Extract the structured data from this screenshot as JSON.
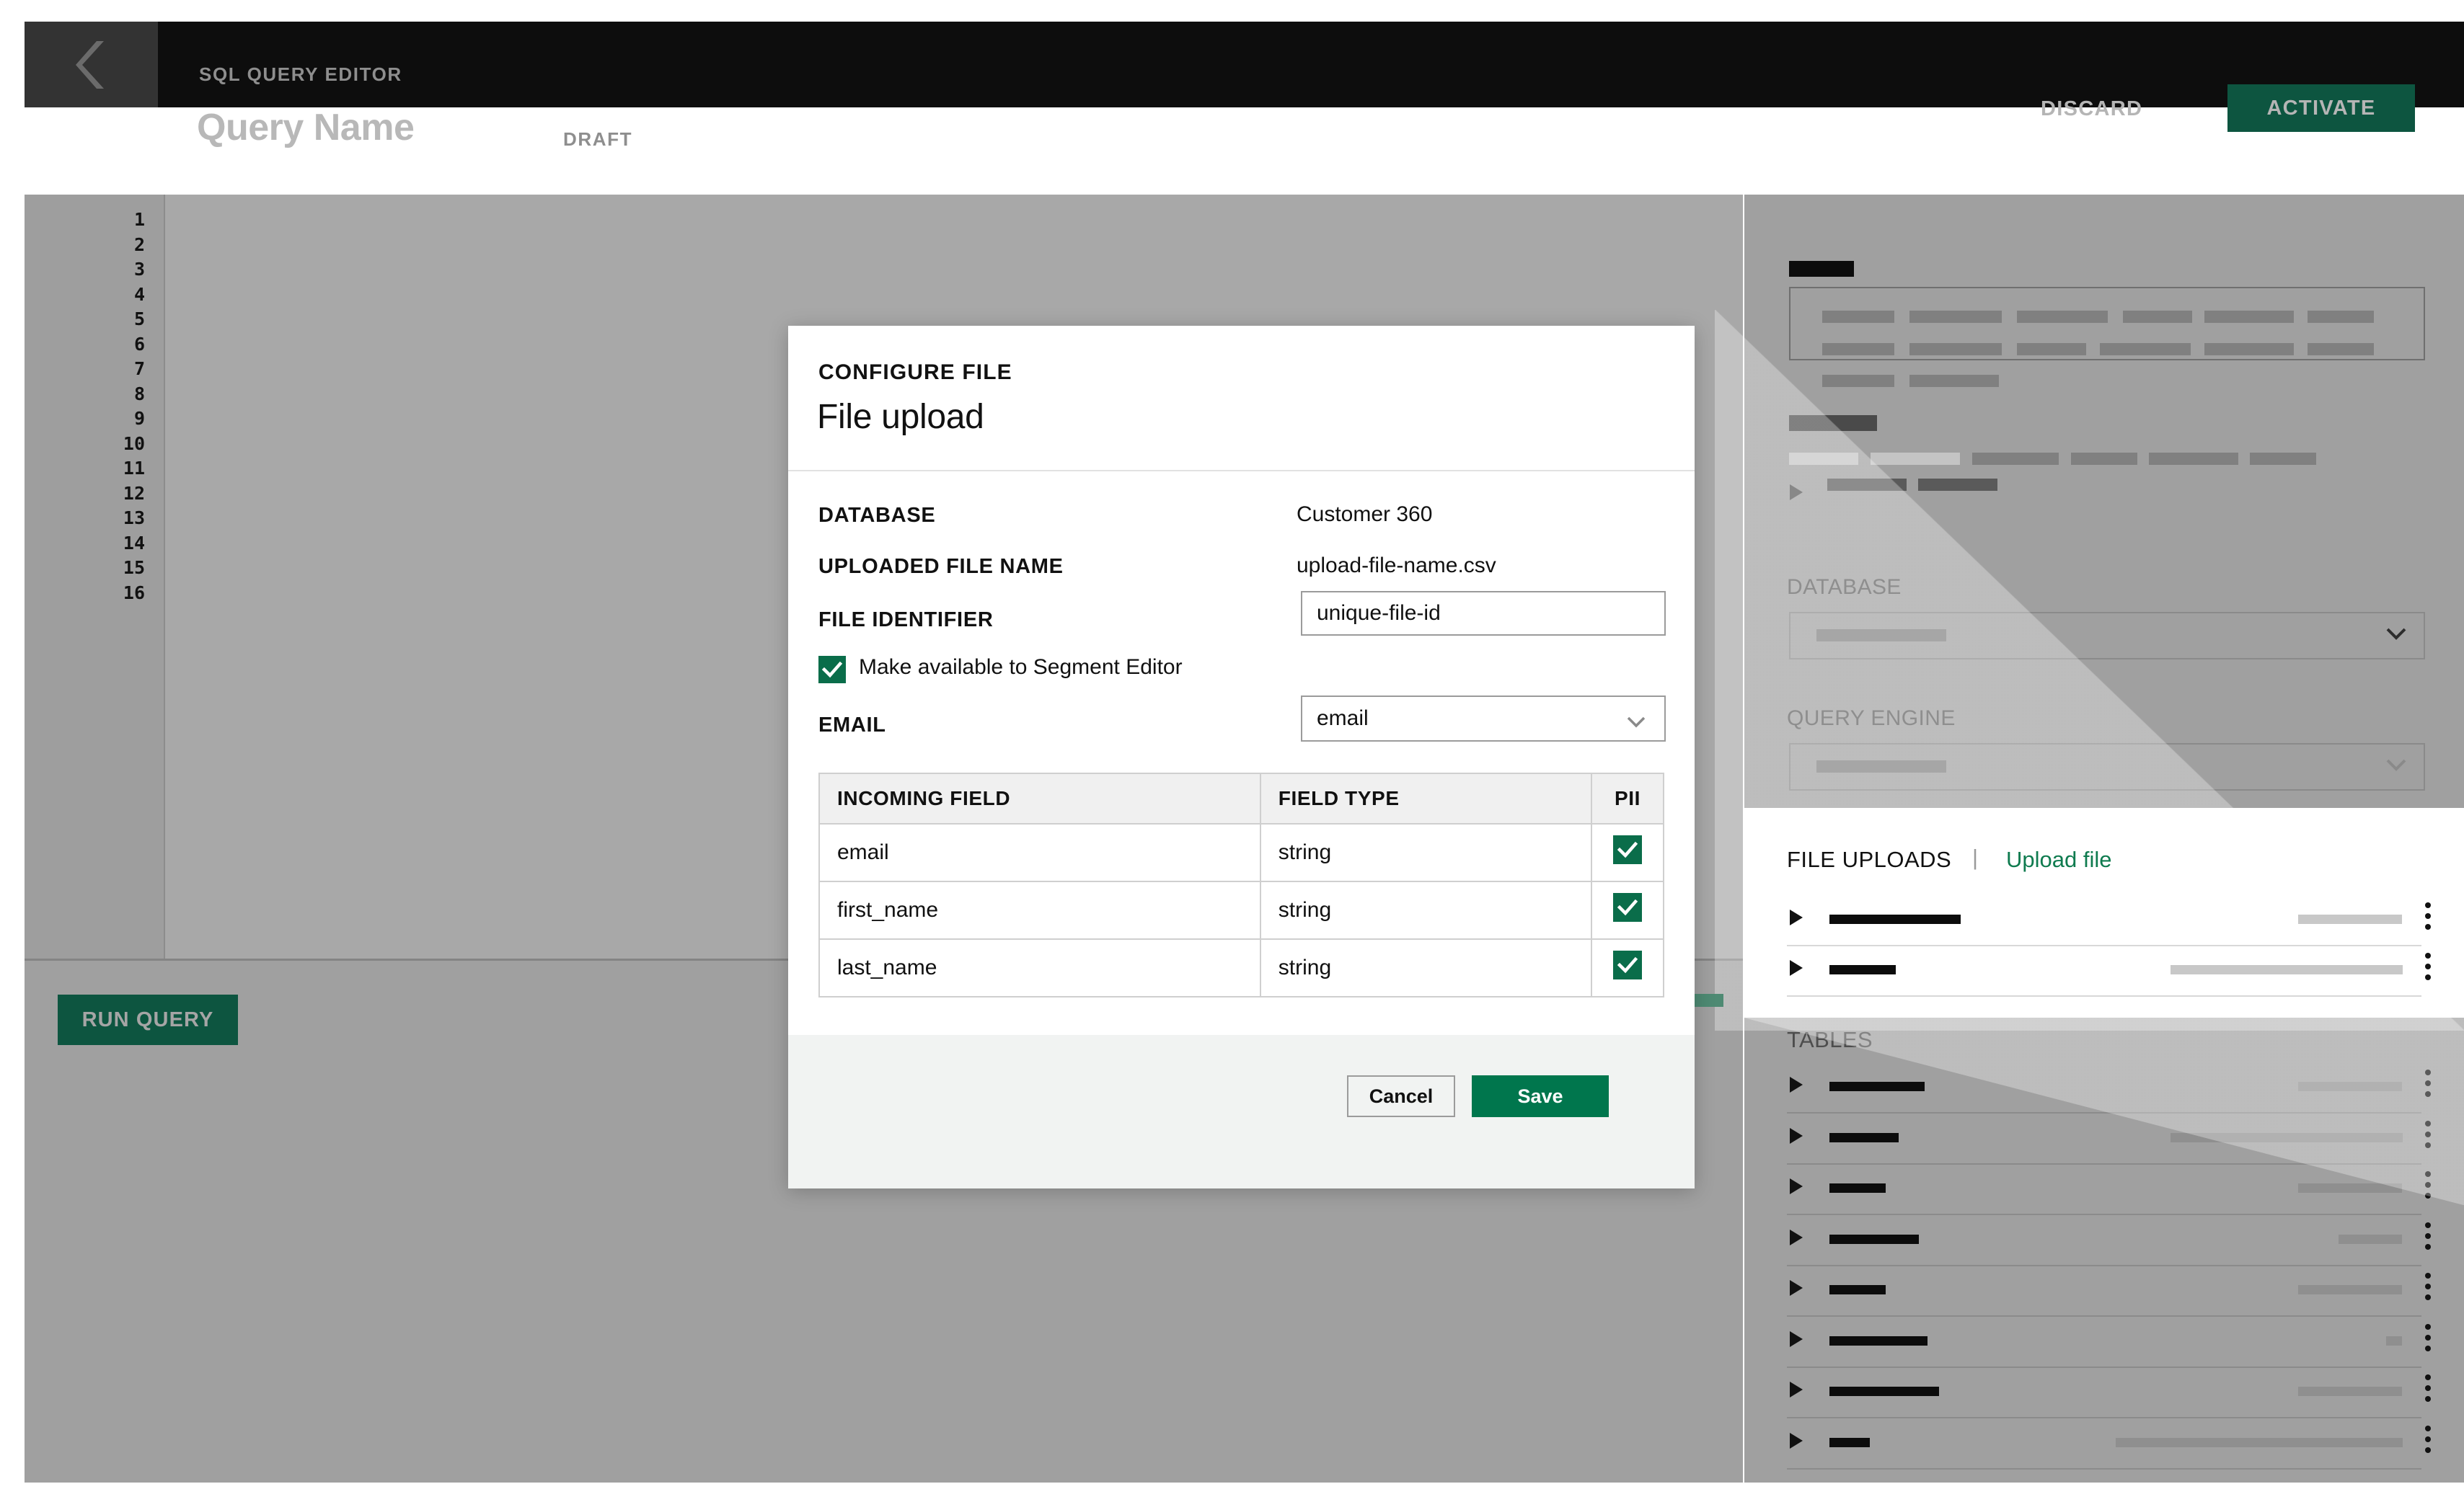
{
  "header": {
    "back_icon": "chevron-left-icon",
    "eyebrow": "SQL QUERY EDITOR",
    "title": "Query Name",
    "status": "DRAFT",
    "discard_label": "DISCARD",
    "activate_label": "ACTIVATE",
    "accent_green": "#0d5540",
    "background": "#0d0d0d"
  },
  "editor": {
    "line_numbers": [
      "1",
      "2",
      "3",
      "4",
      "5",
      "6",
      "7",
      "8",
      "9",
      "10",
      "11",
      "12",
      "13",
      "14",
      "15",
      "16"
    ],
    "run_query_label": "RUN QUERY"
  },
  "sidebar": {
    "database_label": "DATABASE",
    "query_engine_label": "QUERY ENGINE",
    "file_uploads": {
      "title": "FILE UPLOADS",
      "separator": "|",
      "upload_link": "Upload file",
      "link_color": "#0f7b4f",
      "rows": [
        {
          "expand_icon": "triangle-right-icon",
          "menu_icon": "kebab-menu-icon"
        },
        {
          "expand_icon": "triangle-right-icon",
          "menu_icon": "kebab-menu-icon"
        }
      ]
    },
    "tables": {
      "title": "TABLES",
      "rows": [
        {
          "expand_icon": "triangle-right-icon",
          "menu_icon": "kebab-menu-icon"
        },
        {
          "expand_icon": "triangle-right-icon",
          "menu_icon": "kebab-menu-icon"
        },
        {
          "expand_icon": "triangle-right-icon",
          "menu_icon": "kebab-menu-icon"
        },
        {
          "expand_icon": "triangle-right-icon",
          "menu_icon": "kebab-menu-icon"
        },
        {
          "expand_icon": "triangle-right-icon",
          "menu_icon": "kebab-menu-icon"
        },
        {
          "expand_icon": "triangle-right-icon",
          "menu_icon": "kebab-menu-icon"
        },
        {
          "expand_icon": "triangle-right-icon",
          "menu_icon": "kebab-menu-icon"
        },
        {
          "expand_icon": "triangle-right-icon",
          "menu_icon": "kebab-menu-icon"
        }
      ]
    }
  },
  "modal": {
    "eyebrow": "CONFIGURE FILE",
    "title": "File upload",
    "fields": {
      "database_label": "DATABASE",
      "database_value": "Customer 360",
      "uploaded_file_label": "UPLOADED FILE NAME",
      "uploaded_file_value": "upload-file-name.csv",
      "file_identifier_label": "FILE IDENTIFIER",
      "file_identifier_value": "unique-file-id",
      "file_identifier_placeholder": "unique-file-id",
      "segment_checkbox_label": "Make available to Segment Editor",
      "segment_checkbox_checked": true,
      "email_label": "EMAIL",
      "email_value": "email",
      "email_options": [
        "email"
      ]
    },
    "table": {
      "columns": [
        "INCOMING FIELD",
        "FIELD TYPE",
        "PII"
      ],
      "rows": [
        {
          "field": "email",
          "type": "string",
          "pii": true
        },
        {
          "field": "first_name",
          "type": "string",
          "pii": true
        },
        {
          "field": "last_name",
          "type": "string",
          "pii": true
        }
      ]
    },
    "footer": {
      "cancel_label": "Cancel",
      "save_label": "Save",
      "save_color": "#00764d"
    }
  }
}
